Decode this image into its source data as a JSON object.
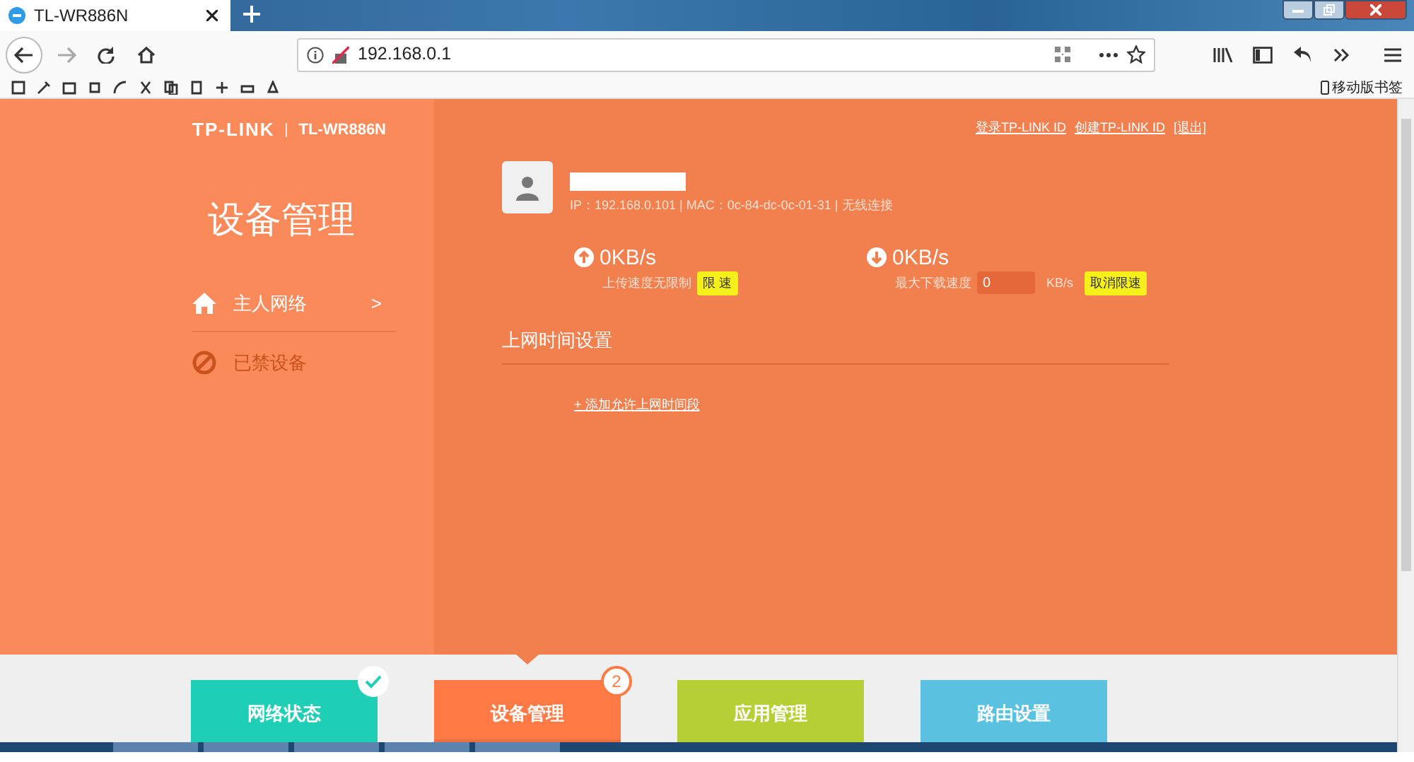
{
  "browser": {
    "tab": {
      "title": "TL-WR886N"
    },
    "address": "192.168.0.1",
    "mobile_bookmarks": "移动版书签"
  },
  "header": {
    "logo": "TP-LINK",
    "model": "TL-WR886N",
    "links": [
      "登录TP-LINK ID",
      "创建TP-LINK ID",
      "[退出]"
    ]
  },
  "sidebar": {
    "title": "设备管理",
    "items": [
      {
        "kind": "home",
        "label": "主人网络",
        "arrow": ">",
        "selected": true
      },
      {
        "kind": "ban",
        "label": "已禁设备",
        "selected": false
      }
    ]
  },
  "device": {
    "info": "IP：192.168.0.101 | MAC：0c-84-dc-0c-01-31 | 无线连接",
    "upload": {
      "speed": "0KB/s",
      "note": "上传速度无限制",
      "button": "限 速"
    },
    "download": {
      "speed": "0KB/s",
      "label": "最大下载速度",
      "value": "0",
      "unit": "KB/s",
      "button": "取消限速"
    }
  },
  "time_settings": {
    "title": "上网时间设置",
    "add_link": "+ 添加允许上网时间段"
  },
  "bottom_nav": [
    {
      "label": "网络状态",
      "color": "#1ecfb6",
      "selected": false,
      "badge": {
        "kind": "check"
      }
    },
    {
      "label": "设备管理",
      "color": "#ff7a45",
      "selected": true,
      "badge": {
        "kind": "count",
        "text": "2"
      }
    },
    {
      "label": "应用管理",
      "color": "#b5cf35",
      "selected": false
    },
    {
      "label": "路由设置",
      "color": "#5ac1e0",
      "selected": false
    }
  ]
}
